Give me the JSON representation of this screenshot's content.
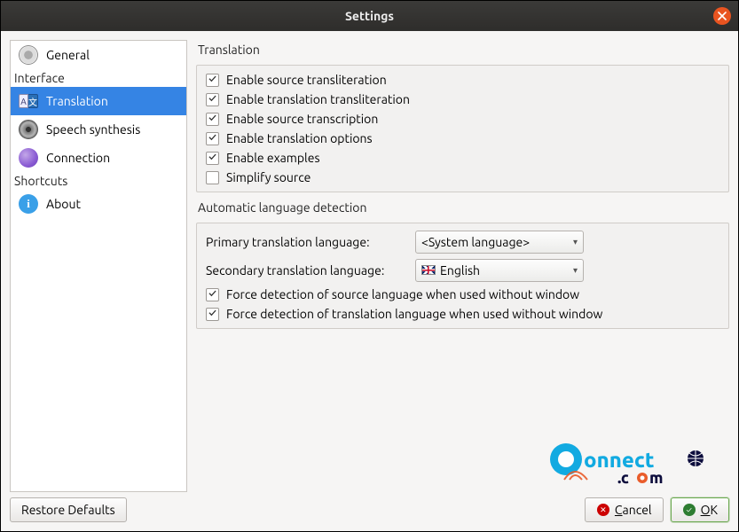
{
  "window": {
    "title": "Settings"
  },
  "sidebar": {
    "interface_label": "Interface",
    "shortcuts_label": "Shortcuts",
    "general": "General",
    "translation": "Translation",
    "speech": "Speech synthesis",
    "connection": "Connection",
    "about": "About"
  },
  "sections": {
    "translation_title": "Translation",
    "auto_detect_title": "Automatic language detection"
  },
  "options": {
    "enable_source_translit": "Enable source transliteration",
    "enable_translation_translit": "Enable translation transliteration",
    "enable_source_transcription": "Enable source transcription",
    "enable_translation_options": "Enable translation options",
    "enable_examples": "Enable examples",
    "simplify_source": "Simplify source"
  },
  "detection": {
    "primary_label": "Primary translation language:",
    "primary_value": "<System language>",
    "secondary_label": "Secondary translation language:",
    "secondary_value": "English",
    "force_source": "Force detection of source language when used without window",
    "force_translation": "Force detection of translation language when used without window"
  },
  "footer": {
    "restore": "Restore Defaults",
    "cancel": "Cancel",
    "ok": "OK"
  }
}
